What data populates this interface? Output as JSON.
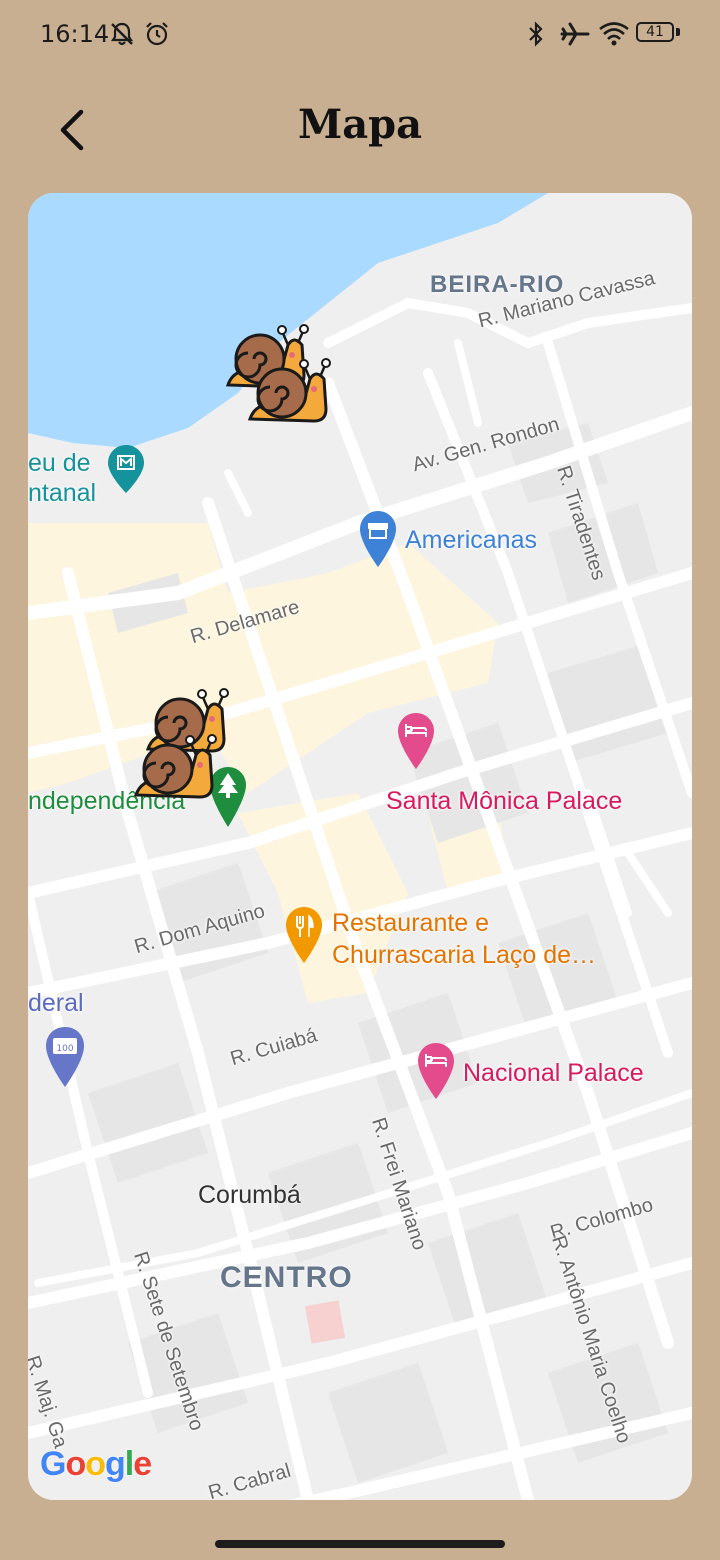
{
  "status_bar": {
    "time": "16:14",
    "battery_level": "41",
    "icons": [
      "notifications-off-icon",
      "alarm-icon",
      "bluetooth-icon",
      "airplane-mode-icon",
      "wifi-icon",
      "battery-icon"
    ]
  },
  "header": {
    "title": "Mapa",
    "back_icon": "chevron-left-icon"
  },
  "map": {
    "districts": {
      "beira_rio": "BEIRA-RIO",
      "centro": "CENTRO"
    },
    "city": "Corumbá",
    "streets": {
      "mariano_cavassa": "R. Mariano Cavassa",
      "gen_rondon": "Av. Gen. Rondon",
      "tiradentes": "R. Tiradentes",
      "delamare": "R. Delamare",
      "dom_aquino": "R. Dom Aquino",
      "cuiaba": "R. Cuiabá",
      "frei_mariano": "R. Frei Mariano",
      "colombo": "R. Colombo",
      "antonio_maria_coelho": "R. Antônio Maria Coelho",
      "sete_de_setembro": "R. Sete de Setembro",
      "cabral": "R. Cabral",
      "maj_ga": "R. Maj. Ga"
    },
    "pois": {
      "museum_line1": "eu de",
      "museum_line2": "ntanal",
      "americanas": "Americanas",
      "santa_monica": "Santa Mônica Palace",
      "independencia": "ndependência",
      "restaurant_line1": "Restaurante e",
      "restaurant_line2": "Churrascaria Laço de…",
      "federal": "deral",
      "nacional_palace": "Nacional Palace"
    },
    "poi_colors": {
      "museum": "#14939c",
      "shopping": "#3e82d8",
      "hotel": "#d81b60",
      "park": "#1e8e3e",
      "restaurant": "#e37400",
      "landmark": "#5c6bc0"
    },
    "water_color": "#aadaff",
    "logo": "Google"
  }
}
